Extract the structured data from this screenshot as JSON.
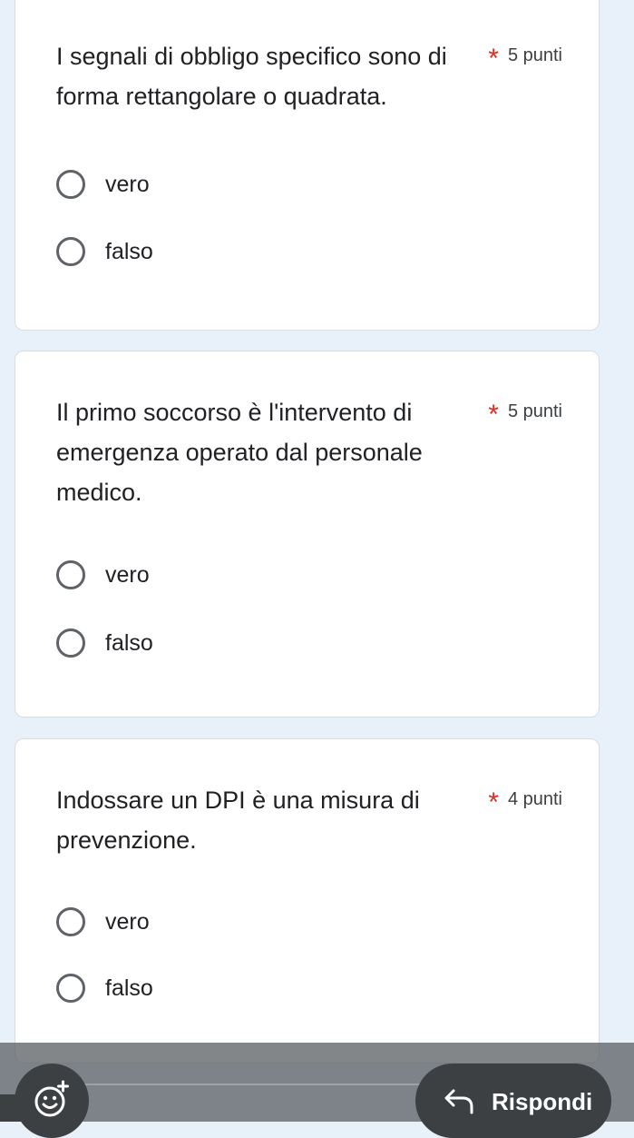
{
  "questions": [
    {
      "text": "I segnali di obbligo specifico sono di forma rettangolare o quadrata.",
      "required": "*",
      "points": "5 punti",
      "options": [
        "vero",
        "falso"
      ]
    },
    {
      "text": "Il primo soccorso è l'intervento di emergenza operato dal personale medico.",
      "required": "*",
      "points": "5 punti",
      "options": [
        "vero",
        "falso"
      ]
    },
    {
      "text": "Indossare un DPI è una misura di prevenzione.",
      "required": "*",
      "points": "4 punti",
      "options": [
        "vero",
        "falso"
      ]
    }
  ],
  "bottom_bar": {
    "reply_label": "Rispondi",
    "emoji_icon": "add-reaction-icon",
    "reply_icon": "reply-arrow-icon"
  },
  "colors": {
    "background": "#e8f0fa",
    "header_accent": "#6fa8e6",
    "required": "#d93025",
    "pill": "#3c4043"
  }
}
